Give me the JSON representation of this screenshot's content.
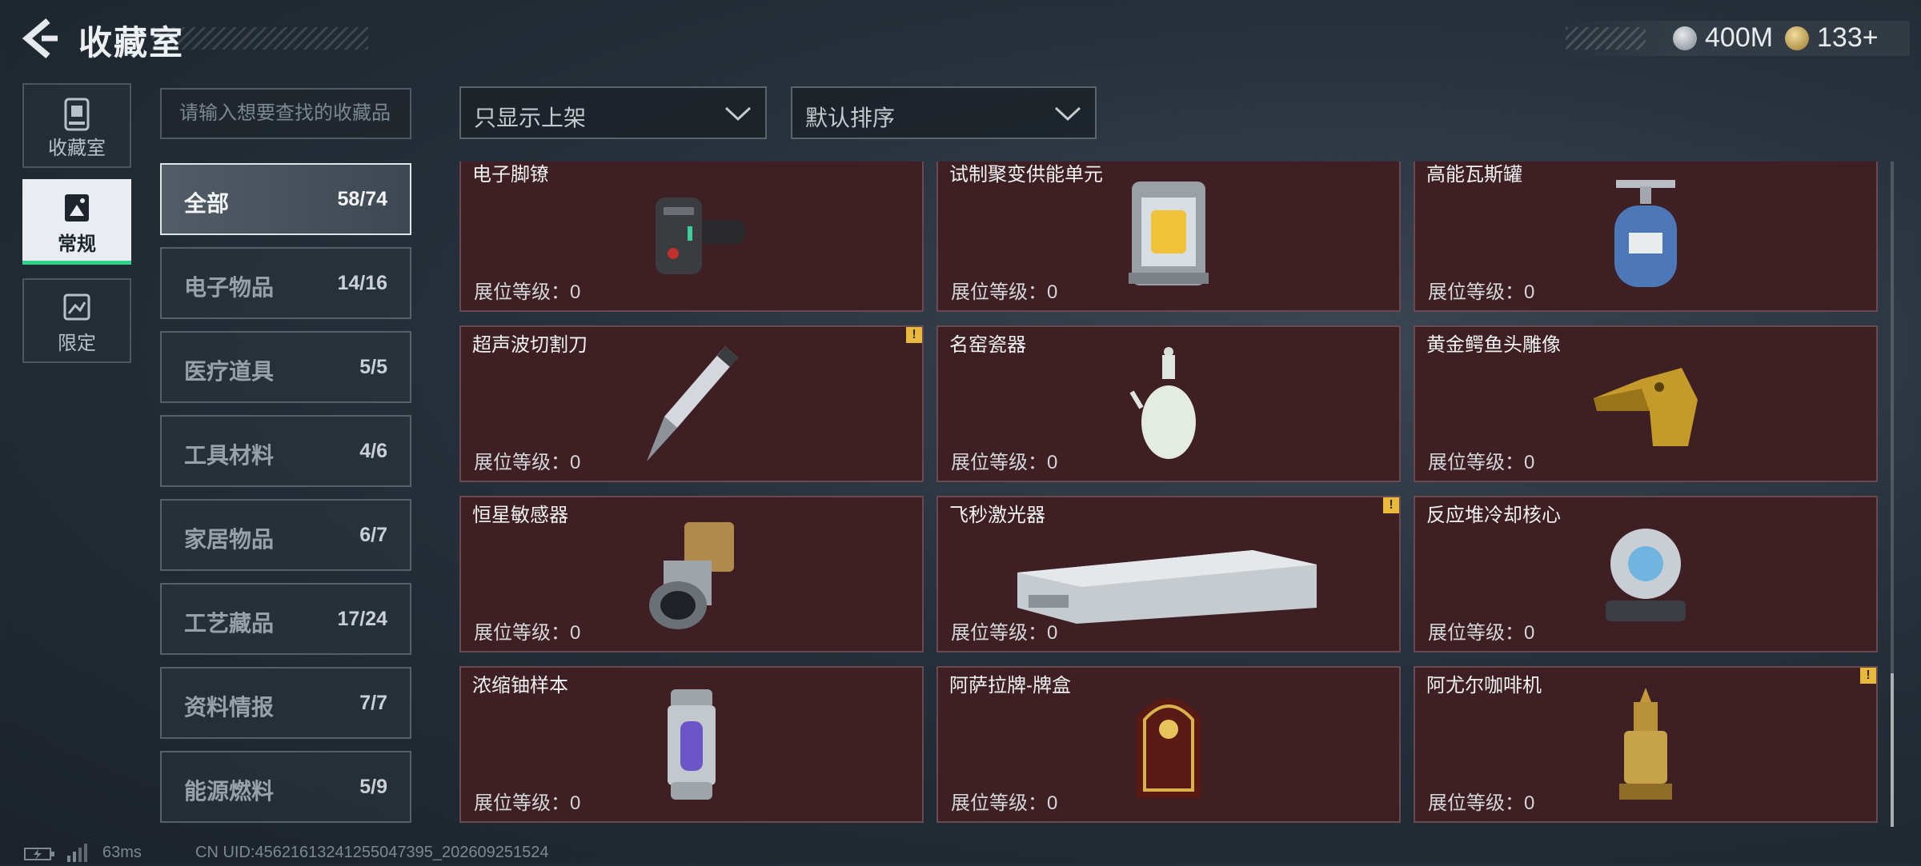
{
  "header": {
    "title": "收藏室",
    "currency_a": "400M",
    "currency_b": "133+"
  },
  "rail": [
    {
      "label": "收藏室"
    },
    {
      "label": "常规"
    },
    {
      "label": "限定"
    }
  ],
  "search": {
    "placeholder": "请输入想要查找的收藏品"
  },
  "filters": {
    "listed": "只显示上架",
    "sort": "默认排序"
  },
  "categories": [
    {
      "name": "全部",
      "count": "58/74"
    },
    {
      "name": "电子物品",
      "count": "14/16"
    },
    {
      "name": "医疗道具",
      "count": "5/5"
    },
    {
      "name": "工具材料",
      "count": "4/6"
    },
    {
      "name": "家居物品",
      "count": "6/7"
    },
    {
      "name": "工艺藏品",
      "count": "17/24"
    },
    {
      "name": "资料情报",
      "count": "7/7"
    },
    {
      "name": "能源燃料",
      "count": "5/9"
    }
  ],
  "level_label": "展位等级：0",
  "items": [
    {
      "name": "电子脚镣",
      "icon": "ankle-monitor-icon"
    },
    {
      "name": "试制聚变供能单元",
      "icon": "fusion-unit-icon"
    },
    {
      "name": "高能瓦斯罐",
      "icon": "gas-canister-icon"
    },
    {
      "name": "超声波切割刀",
      "icon": "ultrasonic-knife-icon",
      "warning": "!"
    },
    {
      "name": "名窑瓷器",
      "icon": "porcelain-vase-icon"
    },
    {
      "name": "黄金鳄鱼头雕像",
      "icon": "golden-crocodile-icon"
    },
    {
      "name": "恒星敏感器",
      "icon": "star-sensor-icon"
    },
    {
      "name": "飞秒激光器",
      "icon": "femtosecond-laser-icon",
      "warning": "!"
    },
    {
      "name": "反应堆冷却核心",
      "icon": "reactor-core-icon"
    },
    {
      "name": "浓缩铀样本",
      "icon": "uranium-sample-icon"
    },
    {
      "name": "阿萨拉牌-牌盒",
      "icon": "card-box-icon"
    },
    {
      "name": "阿尤尔咖啡机",
      "icon": "coffee-machine-icon",
      "warning": "!"
    }
  ],
  "footer": {
    "ping": "63ms",
    "uid": "CN UID:456216132412550473​95_202609251524"
  }
}
